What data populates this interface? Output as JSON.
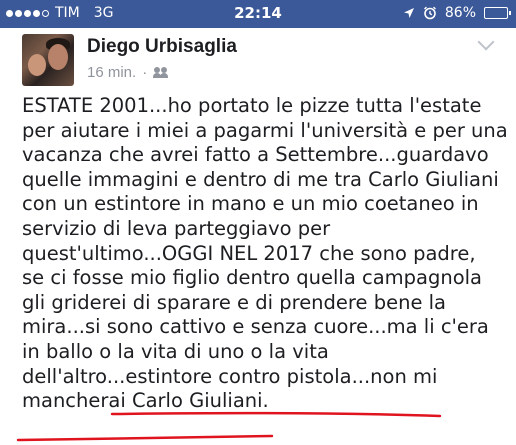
{
  "status_bar": {
    "carrier": "TIM",
    "network": "3G",
    "time": "22:14",
    "battery": "86%",
    "battery_level": 0.86,
    "signal_bars_filled": 4,
    "signal_bars_total": 5,
    "icons": [
      "location-arrow-icon",
      "alarm-clock-icon",
      "battery-icon"
    ]
  },
  "post": {
    "author": "Diego Urbisaglia",
    "time": "16 min.",
    "separator": "·",
    "audience_icon": "friends-icon",
    "menu_icon": "chevron-down-icon",
    "text_lines": [
      "ESTATE 2001...ho portato le pizze tutta l'estate",
      "per aiutare i miei a pagarmi l'università e per una",
      "vacanza che avrei fatto a Settembre...guardavo",
      "quelle immagini e dentro di me tra Carlo Giuliani",
      "con un estintore in mano e un mio coetaneo in",
      "servizio di leva parteggiavo per",
      "quest'ultimo...OGGI NEL 2017 che sono padre,",
      "se ci fosse mio figlio dentro quella campagnola",
      "gli griderei di sparare e di prendere bene la",
      "mira...si sono cattivo e senza cuore...ma li c'era",
      "in ballo o la vita di uno o la vita",
      "dell'altro...estintore contro pistola...non mi",
      "mancherai Carlo Giuliani."
    ]
  },
  "colors": {
    "status_bar_bg": "#3b5998",
    "text": "#1c1e21",
    "meta": "#90949c",
    "highlight_underline": "#e0141e"
  }
}
